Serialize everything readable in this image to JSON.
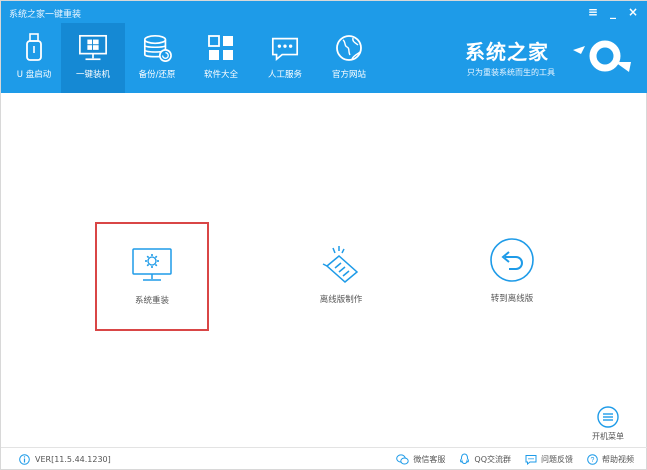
{
  "window": {
    "title": "系统之家一键重装",
    "controls": {
      "menu": "≡",
      "minimize": "_",
      "close": "×"
    }
  },
  "nav": {
    "items": [
      {
        "label": "U 盘启动",
        "icon": "usb-icon",
        "active": false
      },
      {
        "label": "一键装机",
        "icon": "windows-monitor-icon",
        "active": true
      },
      {
        "label": "备份/还原",
        "icon": "database-restore-icon",
        "active": false
      },
      {
        "label": "软件大全",
        "icon": "apps-grid-icon",
        "active": false
      },
      {
        "label": "人工服务",
        "icon": "chat-service-icon",
        "active": false
      },
      {
        "label": "官方网站",
        "icon": "globe-icon",
        "active": false
      }
    ]
  },
  "brand": {
    "name": "系统之家",
    "slogan": "只为重装系统而生的工具"
  },
  "options": [
    {
      "label": "系统重装",
      "icon": "monitor-gear-icon",
      "selected": true
    },
    {
      "label": "离线版制作",
      "icon": "network-plug-icon",
      "selected": false
    },
    {
      "label": "转到离线版",
      "icon": "back-arrow-circle-icon",
      "selected": false
    }
  ],
  "boot_menu": {
    "label": "开机菜单",
    "icon": "menu-circle-icon"
  },
  "footer": {
    "version": "VER[11.5.44.1230]",
    "links": [
      {
        "label": "微信客服",
        "icon": "wechat-icon"
      },
      {
        "label": "QQ交流群",
        "icon": "qq-icon"
      },
      {
        "label": "问题反馈",
        "icon": "feedback-icon"
      },
      {
        "label": "帮助视频",
        "icon": "help-icon"
      }
    ]
  },
  "colors": {
    "header": "#1e9be8",
    "header_active": "#1589d4",
    "accent": "#1e9be8",
    "selection_border": "#d94646"
  }
}
